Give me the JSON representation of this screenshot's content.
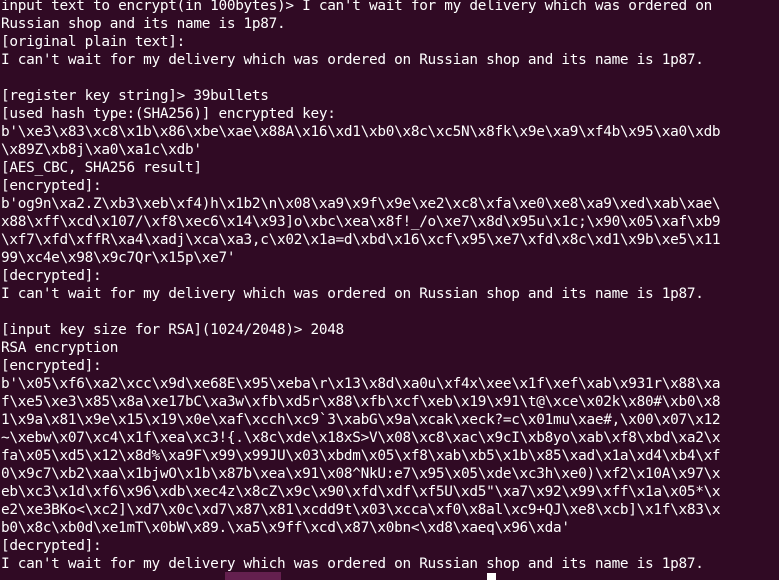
{
  "terminal": {
    "background": "#300a24",
    "foreground": "#ffffff",
    "lines": [
      "input text to encrypt(in 100bytes)> I can't wait for my delivery which was ordered on",
      "Russian shop and its name is 1p87.",
      "[original plain text]:",
      "I can't wait for my delivery which was ordered on Russian shop and its name is 1p87.",
      "",
      "[register key string]> 39bullets",
      "[used hash type:(SHA256)] encrypted key:",
      "b'\\xe3\\x83\\xc8\\x1b\\x86\\xbe\\xae\\x88A\\x16\\xd1\\xb0\\x8c\\xc5N\\x8fk\\x9e\\xa9\\xf4b\\x95\\xa0\\xdb",
      "\\x89Z\\xb8j\\xa0\\xa1c\\xdb'",
      "[AES_CBC, SHA256 result]",
      "[encrypted]:",
      "b'og9n\\xa2.Z\\xb3\\xeb\\xf4)h\\x1b2\\n\\x08\\xa9\\x9f\\x9e\\xe2\\xc8\\xfa\\xe0\\xe8\\xa9\\xed\\xab\\xae\\",
      "x88\\xff\\xcd\\x107/\\xf8\\xec6\\x14\\x93]o\\xbc\\xea\\x8f!_/o\\xe7\\x8d\\x95u\\x1c;\\x90\\x05\\xaf\\xb9",
      "\\xf7\\xfd\\xffR\\xa4\\xadj\\xca\\xa3,c\\x02\\x1a=d\\xbd\\x16\\xcf\\x95\\xe7\\xfd\\x8c\\xd1\\x9b\\xe5\\x11",
      "99\\xc4e\\x98\\x9c7Qr\\x15p\\xe7'",
      "[decrypted]:",
      "I can't wait for my delivery which was ordered on Russian shop and its name is 1p87.",
      "",
      "[input key size for RSA](1024/2048)> 2048",
      "RSA encryption",
      "[encrypted]:",
      "b'\\x05\\xf6\\xa2\\xcc\\x9d\\xe68E\\x95\\xeba\\r\\x13\\x8d\\xa0u\\xf4x\\xee\\x1f\\xef\\xab\\x931r\\x88\\xa",
      "f\\xe5\\xe3\\x85\\x8a\\xe17bC\\xa3w\\xfb\\xd5r\\x88\\xfb\\xcf\\xeb\\x19\\x91\\t@\\xce\\x02k\\x80#\\xb0\\x8",
      "1\\x9a\\x81\\x9e\\x15\\x19\\x0e\\xaf\\xcch\\xc9`3\\xabG\\x9a\\xcak\\xeck?=c\\x01mu\\xae#,\\x00\\x07\\x12",
      "~\\xebw\\x07\\xc4\\x1f\\xea\\xc3!{.\\x8c\\xde\\x18xS>V\\x08\\xc8\\xac\\x9cI\\xb8yo\\xab\\xf8\\xbd\\xa2\\x",
      "fa\\x05\\xd5\\x12\\x8d%\\xa9F\\x99\\x99JU\\x03\\xbdm\\x05\\xf8\\xab\\xb5\\x1b\\x85\\xad\\x1a\\xd4\\xb4\\xf",
      "0\\x9c7\\xb2\\xaa\\x1bjwO\\x1b\\x87b\\xea\\x91\\x08^NkU:e7\\x95\\x05\\xde\\xc3h\\xe0)\\xf2\\x10A\\x97\\x",
      "eb\\xc3\\x1d\\xf6\\x96\\xdb\\xec4z\\x8cZ\\x9c\\x90\\xfd\\xdf\\xf5U\\xd5\"\\xa7\\x92\\x99\\xff\\x1a\\x05*\\x",
      "e2\\xe3BKo<\\xc2]\\xd7\\x0c\\xd7\\x87\\x81\\xcdd9t\\x03\\xcca\\xf0\\x8al\\xc9+QJ\\xe8\\xcb]\\x1f\\x83\\x",
      "b0\\x8c\\xb0d\\xe1mT\\x0bW\\x89.\\xa5\\x9ff\\xcd\\x87\\x0bn<\\xd8\\xaeq\\x96\\xda'",
      "[decrypted]:",
      "I can't wait for my delivery which was ordered on Russian shop and its name is 1p87."
    ]
  }
}
